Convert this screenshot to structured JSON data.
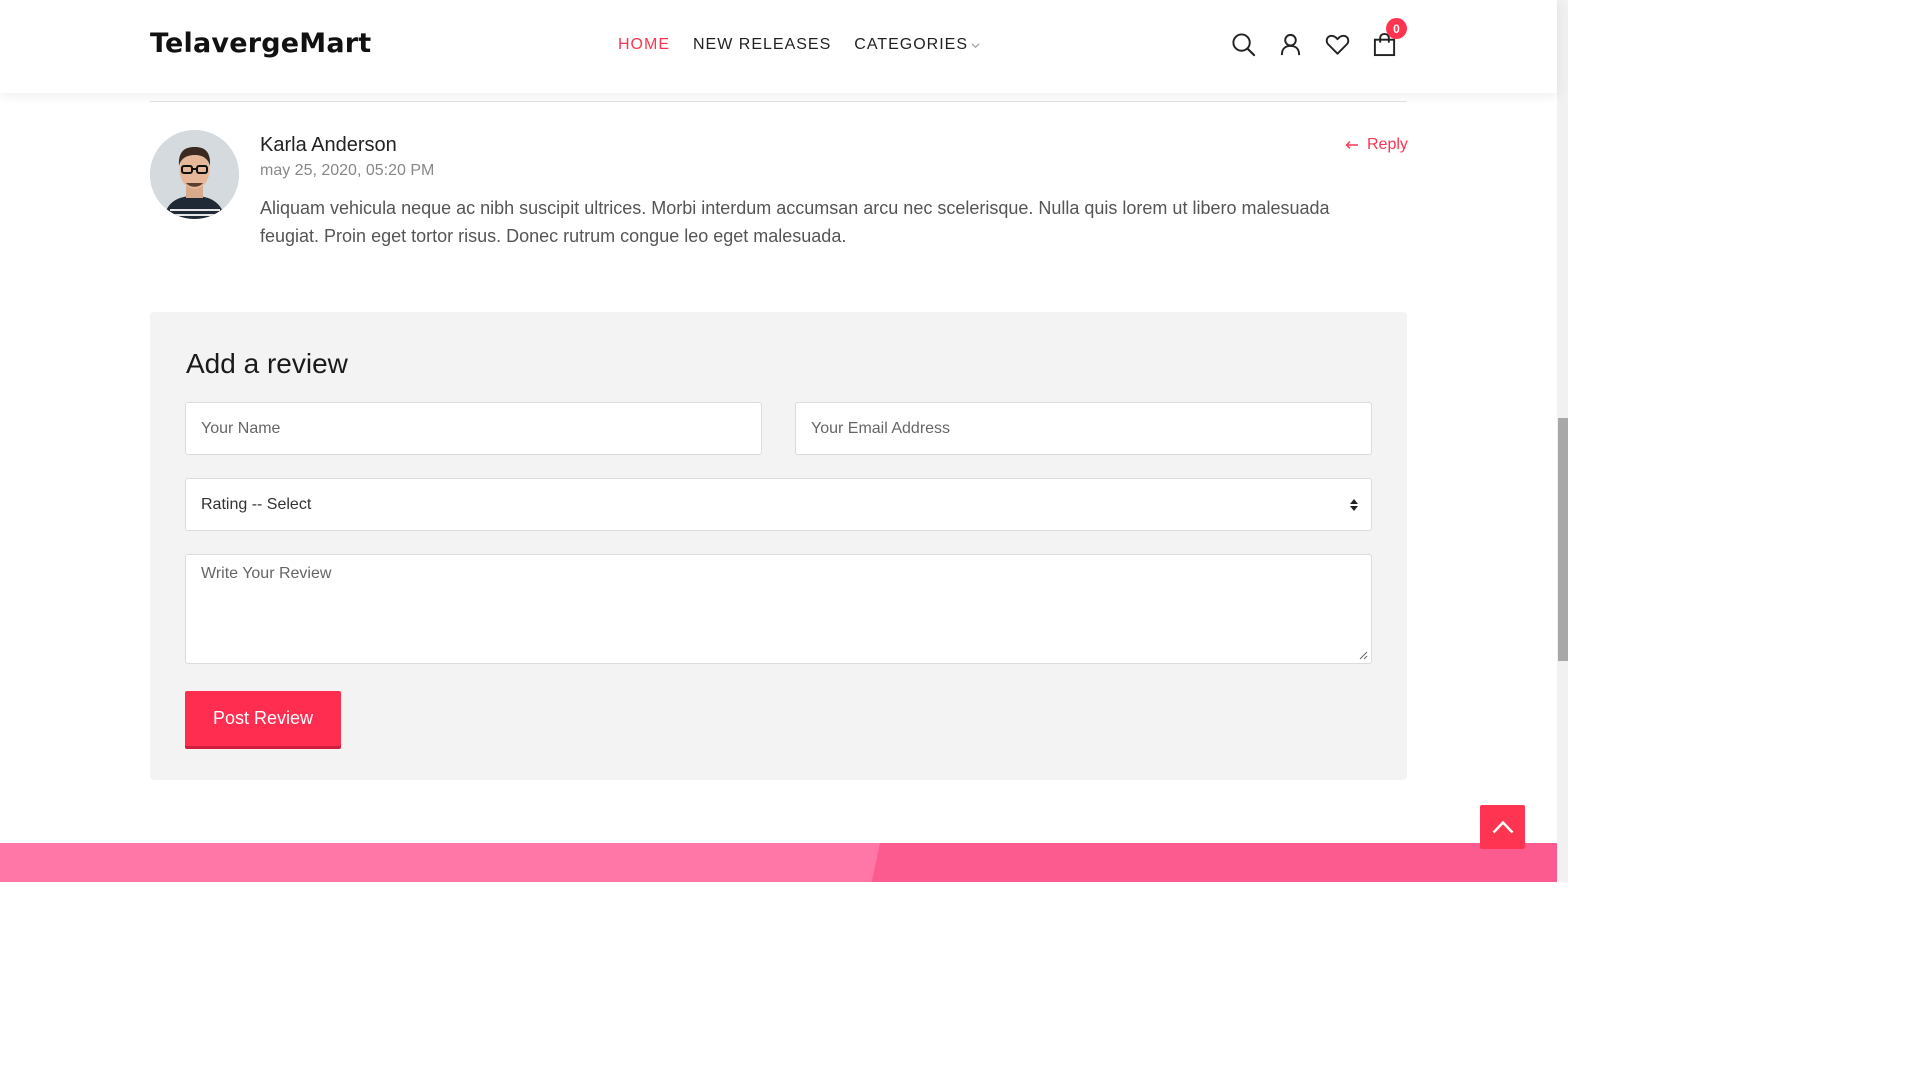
{
  "brand": {
    "logo_text": "TelavergeMart",
    "accent_color": "#ff3451"
  },
  "nav": {
    "items": [
      {
        "label": "HOME",
        "active": true
      },
      {
        "label": "NEW RELEASES",
        "active": false
      },
      {
        "label": "CATEGORIES",
        "active": false,
        "dropdown": true
      }
    ]
  },
  "header_icons": {
    "search": "search-icon",
    "account": "user-icon",
    "wishlist": "heart-icon",
    "cart": "shopping-bag-icon",
    "cart_count": "0"
  },
  "comment": {
    "author": "Karla Anderson",
    "date": "may 25, 2020, 05:20 PM",
    "reply_label": "Reply",
    "text": "Aliquam vehicula neque ac nibh suscipit ultrices. Morbi interdum accumsan arcu nec scelerisque. Nulla quis lorem ut libero malesuada feugiat. Proin eget tortor risus. Donec rutrum congue leo eget malesuada."
  },
  "review_form": {
    "title": "Add a review",
    "name_placeholder": "Your Name",
    "email_placeholder": "Your Email Address",
    "rating_selected": "Rating -- Select",
    "review_placeholder": "Write Your Review",
    "submit_label": "Post Review"
  },
  "colors": {
    "footer_left": "#ff77a6",
    "footer_right": "#fc5b8f",
    "form_bg": "#f3f3f3"
  }
}
